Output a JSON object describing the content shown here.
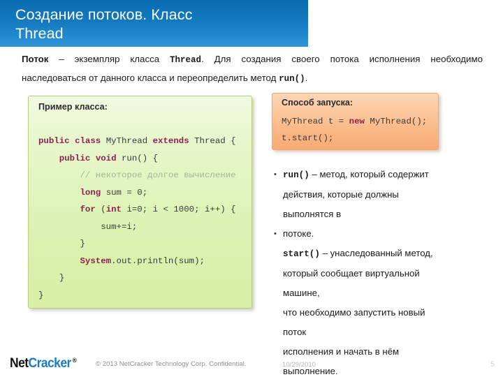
{
  "slide": {
    "title": "Создание потоков. Класс\nThread",
    "accent_color": "#1277bd"
  },
  "intro": {
    "line1_lead": "Поток",
    "line1_mid": " – экземпляр класса ",
    "line1_mono": "Thread",
    "line1_tail": ". Для создания своего потока исполнения необходимо",
    "line2": "наследоваться от данного класса и переопределить метод ",
    "line2_mono": "run()",
    "line2_tail": "."
  },
  "code_box": {
    "title": "Пример класса:",
    "bg_color": "#ddf2b4",
    "border_color": "#b6cf7c",
    "lines": [
      [
        {
          "t": "public ",
          "c": "kw"
        },
        {
          "t": "class ",
          "c": "kw"
        },
        {
          "t": "MyThread ",
          "c": "pl"
        },
        {
          "t": "extends ",
          "c": "kw"
        },
        {
          "t": "Thread {",
          "c": "pl"
        }
      ],
      [
        {
          "t": "    ",
          "c": "pl"
        },
        {
          "t": "public ",
          "c": "kw"
        },
        {
          "t": "void ",
          "c": "kw"
        },
        {
          "t": "run() {",
          "c": "pl"
        }
      ],
      [
        {
          "t": "        ",
          "c": "pl"
        },
        {
          "t": "// некоторое долгое вычисление",
          "c": "cmt"
        }
      ],
      [
        {
          "t": "        ",
          "c": "pl"
        },
        {
          "t": "long ",
          "c": "kw"
        },
        {
          "t": "sum = 0;",
          "c": "pl"
        }
      ],
      [
        {
          "t": "        ",
          "c": "pl"
        },
        {
          "t": "for ",
          "c": "kw"
        },
        {
          "t": "(",
          "c": "pl"
        },
        {
          "t": "int ",
          "c": "kw"
        },
        {
          "t": "i=0; i < 1000; i++) {",
          "c": "pl"
        }
      ],
      [
        {
          "t": "            sum+=i;",
          "c": "pl"
        }
      ],
      [
        {
          "t": "        }",
          "c": "pl"
        }
      ],
      [
        {
          "t": "        ",
          "c": "pl"
        },
        {
          "t": "System",
          "c": "kw"
        },
        {
          "t": ".out.println(sum);",
          "c": "pl"
        }
      ],
      [
        {
          "t": "    }",
          "c": "pl"
        }
      ],
      [
        {
          "t": "}",
          "c": "pl"
        }
      ]
    ]
  },
  "run_box": {
    "title": "Способ запуска:",
    "bg_color": "#fab482",
    "border_color": "#f3a873",
    "lines": [
      [
        {
          "t": "MyThread t = ",
          "c": "pl"
        },
        {
          "t": "new ",
          "c": "kw"
        },
        {
          "t": "MyThread();",
          "c": "pl"
        }
      ],
      [
        {
          "t": "t.start();",
          "c": "pl"
        }
      ]
    ]
  },
  "bullets": [
    {
      "bullet": true,
      "mono": "run()",
      "text": " – метод, который содержит"
    },
    {
      "bullet": false,
      "mono": "",
      "text": "действия, которые должны"
    },
    {
      "bullet": false,
      "mono": "",
      "text": "выполнятся в"
    },
    {
      "bullet": true,
      "mono": "",
      "text": "потоке."
    },
    {
      "bullet": false,
      "mono": "start()",
      "text": " – унаследованный метод,"
    },
    {
      "bullet": false,
      "mono": "",
      "text": "который сообщает виртуальной"
    },
    {
      "bullet": false,
      "mono": "",
      "text": "машине,"
    },
    {
      "bullet": false,
      "mono": "",
      "text": "что необходимо запустить новый"
    },
    {
      "bullet": false,
      "mono": "",
      "text": "поток"
    },
    {
      "bullet": false,
      "mono": "",
      "text": "исполнения и начать в нём"
    },
    {
      "bullet": false,
      "mono": "",
      "text": "выполнение."
    }
  ],
  "footer": {
    "logo_part1": "Net",
    "logo_part2": "Cracker",
    "logo_reg": "®",
    "logo_color": "#1b7bc4",
    "copyright": "© 2013 NetCracker Technology Corp. Confidential.",
    "date": "10/29/2010",
    "page_number": "5"
  }
}
